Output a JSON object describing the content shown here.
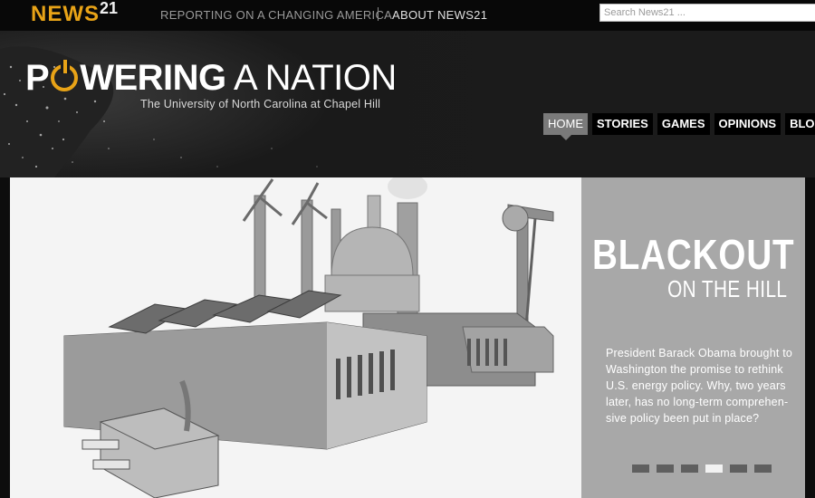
{
  "brand": {
    "name": "NEWS",
    "sup": "21",
    "color": "#e8a317"
  },
  "topbar": {
    "tagline": "REPORTING ON A CHANGING AMERICA",
    "about": "ABOUT NEWS21",
    "search_placeholder": "Search News21 ..."
  },
  "header": {
    "title_p": "P",
    "title_rest": "WERING",
    "title_thin": "A NATION",
    "subtitle": "The University of North Carolina at Chapel Hill",
    "power_icon": "power-icon"
  },
  "nav": {
    "items": [
      {
        "label": "HOME",
        "active": true
      },
      {
        "label": "STORIES",
        "active": false
      },
      {
        "label": "GAMES",
        "active": false
      },
      {
        "label": "OPINIONS",
        "active": false
      },
      {
        "label": "BLOGS",
        "active": false
      }
    ]
  },
  "hero": {
    "headline": "BLACKOUT",
    "subheadline": "ON THE HILL",
    "text": "President Barack Obama brought to Washington the promise to rethink U.S. energy policy. Why, two years later, has no long-term comprehen-sive policy been put in place?",
    "slides_total": 6,
    "slide_active": 4,
    "panel_color": "#a8a8a8"
  }
}
